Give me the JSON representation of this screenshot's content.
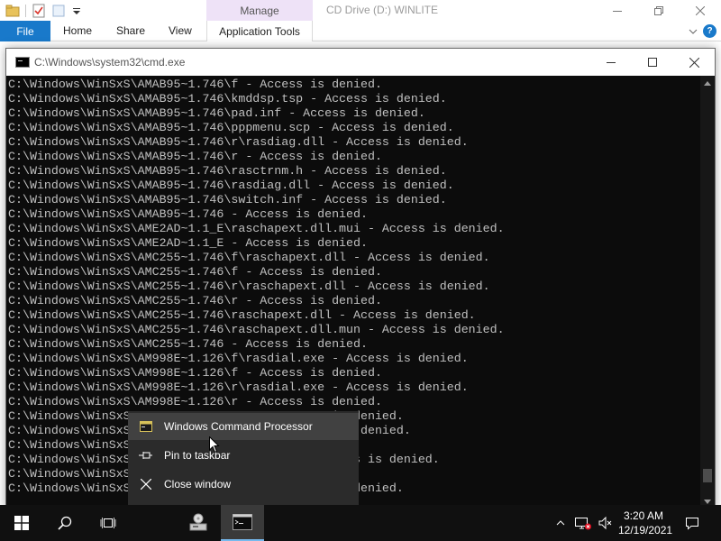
{
  "explorer": {
    "manage_label": "Manage",
    "window_title": "CD Drive (D:) WINLITE",
    "tabs": {
      "file": "File",
      "home": "Home",
      "share": "Share",
      "view": "View",
      "application_tools": "Application Tools"
    },
    "help_label": "?"
  },
  "cmd": {
    "title": "C:\\Windows\\system32\\cmd.exe",
    "lines": [
      "C:\\Windows\\WinSxS\\AMAB95~1.746\\f - Access is denied.",
      "C:\\Windows\\WinSxS\\AMAB95~1.746\\kmddsp.tsp - Access is denied.",
      "C:\\Windows\\WinSxS\\AMAB95~1.746\\pad.inf - Access is denied.",
      "C:\\Windows\\WinSxS\\AMAB95~1.746\\pppmenu.scp - Access is denied.",
      "C:\\Windows\\WinSxS\\AMAB95~1.746\\r\\rasdiag.dll - Access is denied.",
      "C:\\Windows\\WinSxS\\AMAB95~1.746\\r - Access is denied.",
      "C:\\Windows\\WinSxS\\AMAB95~1.746\\rasctrnm.h - Access is denied.",
      "C:\\Windows\\WinSxS\\AMAB95~1.746\\rasdiag.dll - Access is denied.",
      "C:\\Windows\\WinSxS\\AMAB95~1.746\\switch.inf - Access is denied.",
      "C:\\Windows\\WinSxS\\AMAB95~1.746 - Access is denied.",
      "C:\\Windows\\WinSxS\\AME2AD~1.1_E\\raschapext.dll.mui - Access is denied.",
      "C:\\Windows\\WinSxS\\AME2AD~1.1_E - Access is denied.",
      "C:\\Windows\\WinSxS\\AMC255~1.746\\f\\raschapext.dll - Access is denied.",
      "C:\\Windows\\WinSxS\\AMC255~1.746\\f - Access is denied.",
      "C:\\Windows\\WinSxS\\AMC255~1.746\\r\\raschapext.dll - Access is denied.",
      "C:\\Windows\\WinSxS\\AMC255~1.746\\r - Access is denied.",
      "C:\\Windows\\WinSxS\\AMC255~1.746\\raschapext.dll - Access is denied.",
      "C:\\Windows\\WinSxS\\AMC255~1.746\\raschapext.dll.mun - Access is denied.",
      "C:\\Windows\\WinSxS\\AMC255~1.746 - Access is denied.",
      "C:\\Windows\\WinSxS\\AM998E~1.126\\f\\rasdial.exe - Access is denied.",
      "C:\\Windows\\WinSxS\\AM998E~1.126\\f - Access is denied.",
      "C:\\Windows\\WinSxS\\AM998E~1.126\\r\\rasdial.exe - Access is denied.",
      "C:\\Windows\\WinSxS\\AM998E~1.126\\r - Access is denied.",
      "C:\\Windows\\WinSxS                        ess is denied.",
      "C:\\Windows\\WinSxS                         ess is denied.",
      "C:\\Windows\\WinSxS                        d.",
      "C:\\Windows\\WinSxS                        - Access is denied.",
      "C:\\Windows\\WinSxS                        d.",
      "C:\\Windows\\WinSxS                        ess is denied."
    ],
    "scroll_position": 0.97
  },
  "jumplist": {
    "items": [
      {
        "label": "Windows Command Processor",
        "icon": "cmd-app-icon",
        "highlighted": true
      },
      {
        "label": "Pin to taskbar",
        "icon": "pin-icon",
        "highlighted": false
      },
      {
        "label": "Close window",
        "icon": "close-icon",
        "highlighted": false
      }
    ]
  },
  "taskbar": {
    "clock_time": "3:20 AM",
    "clock_date": "12/19/2021"
  },
  "colors": {
    "file_tab": "#1979ca",
    "manage_tab": "#eee2f7",
    "taskbar": "#101010",
    "terminal_bg": "#0c0c0c",
    "terminal_text": "#c0c0c0",
    "active_indicator": "#76b9ed"
  }
}
